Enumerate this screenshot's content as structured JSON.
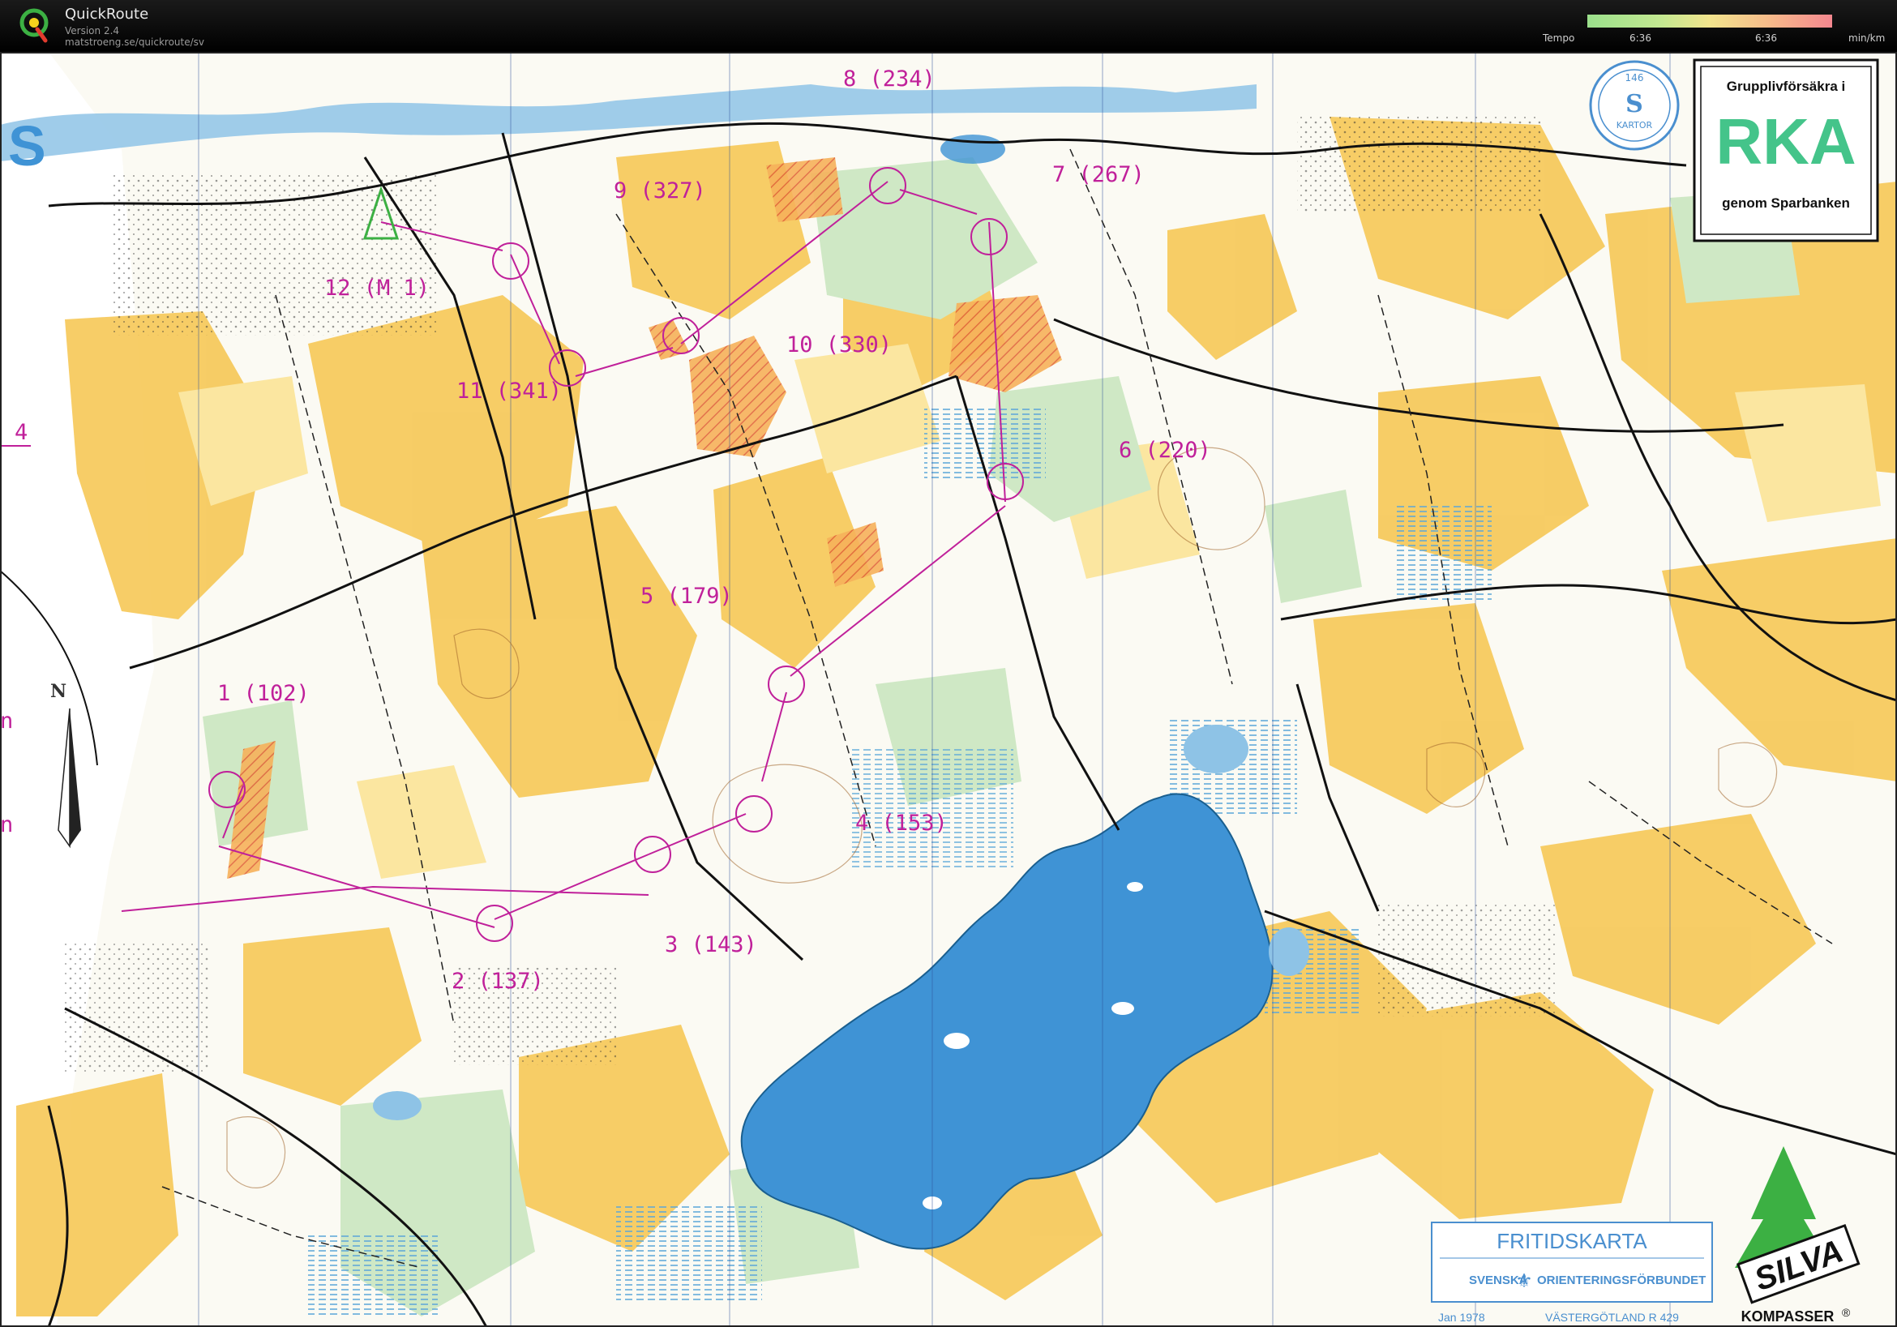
{
  "app": {
    "name": "QuickRoute",
    "version": "Version 2.4",
    "url": "matstroeng.se/quickroute/sv"
  },
  "tempo": {
    "label": "Tempo",
    "value_low": "6:36",
    "value_high": "6:36",
    "unit": "min/km",
    "colors": [
      "#9be08c",
      "#f2e48d",
      "#f4878f"
    ]
  },
  "map": {
    "controls": [
      {
        "label": "1 (102)"
      },
      {
        "label": "2 (137)"
      },
      {
        "label": "3 (143)"
      },
      {
        "label": "4 (153)"
      },
      {
        "label": "5 (179)"
      },
      {
        "label": "6 (220)"
      },
      {
        "label": "7 (267)"
      },
      {
        "label": "8 (234)"
      },
      {
        "label": "9 (327)"
      },
      {
        "label": "10 (330)"
      },
      {
        "label": "11 (341)"
      },
      {
        "label": "12 (M 1)"
      }
    ],
    "edge_marks": {
      "left_number": "4",
      "left_letter_1": "n",
      "left_letter_2": "n"
    },
    "north_arrow_label": "N",
    "sponsor": {
      "line1": "Grupplivförsäkra i",
      "big": "RKA",
      "line2": "genom Sparbanken"
    },
    "stamp": {
      "number": "146",
      "text": "KARTOR"
    },
    "legend": {
      "title": "FRITIDSKARTA",
      "org_left": "SVENSKA",
      "org_right": "ORIENTERINGSFÖRBUNDET",
      "date": "Jan 1978",
      "region": "VÄSTERGÖTLAND R 429"
    },
    "brand": {
      "logo": "SILVA",
      "reg": "®",
      "tagline": "KOMPASSER"
    },
    "colors": {
      "lake": "#3f93d5",
      "open_land": "#f6c95a",
      "rough_open": "#fbe6a0",
      "forest_green": "#cfe8c5",
      "control_magenta": "#c0209a",
      "sponsor_green": "#44c48a"
    }
  }
}
